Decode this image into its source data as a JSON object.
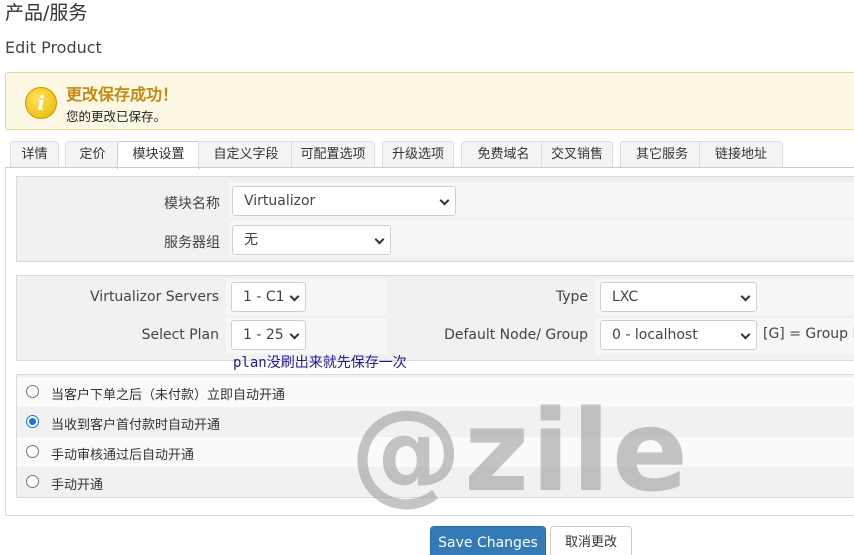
{
  "header": {
    "title": "产品/服务",
    "subtitle": "Edit Product"
  },
  "alert": {
    "icon": "info-icon",
    "icon_glyph": "i",
    "title": "更改保存成功！",
    "message": "您的更改已保存。"
  },
  "tabs": [
    {
      "label": "详情",
      "active": false
    },
    {
      "label": "定价",
      "active": false
    },
    {
      "label": "模块设置",
      "active": true
    },
    {
      "label": "自定义字段",
      "active": false
    },
    {
      "label": "可配置选项",
      "active": false
    },
    {
      "label": "升级选项",
      "active": false
    },
    {
      "label": "免费域名",
      "active": false
    },
    {
      "label": "交叉销售",
      "active": false
    },
    {
      "label": "其它服务",
      "active": false
    },
    {
      "label": "链接地址",
      "active": false
    }
  ],
  "module": {
    "name_label": "模块名称",
    "name_value": "Virtualizor",
    "group_label": "服务器组",
    "group_value": "无"
  },
  "config": {
    "servers_label": "Virtualizor Servers",
    "servers_value": "1 - C1",
    "plan_label": "Select Plan",
    "plan_value": "1 - 25",
    "type_label": "Type",
    "type_value": "LXC",
    "node_label": "Default Node/ Group",
    "node_value": "0 - localhost",
    "node_suffix": "[G] = Group Na"
  },
  "note": "plan没刷出来就先保存一次",
  "provisioning": {
    "options": [
      {
        "label": "当客户下单之后（未付款）立即自动开通",
        "selected": false
      },
      {
        "label": "当收到客户首付款时自动开通",
        "selected": true
      },
      {
        "label": "手动审核通过后自动开通",
        "selected": false
      },
      {
        "label": "手动开通",
        "selected": false
      }
    ]
  },
  "watermark": "@zile",
  "actions": {
    "save_label": "Save Changes",
    "cancel_label": "取消更改"
  }
}
